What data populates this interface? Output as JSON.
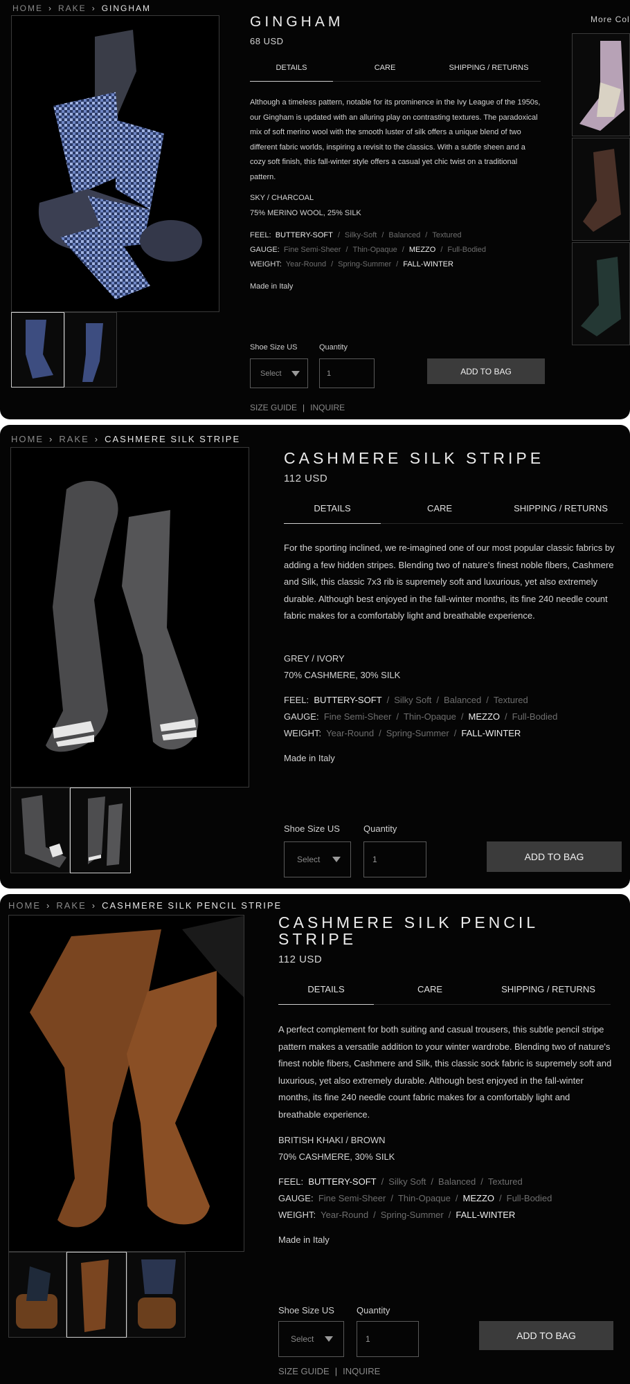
{
  "products": [
    {
      "breadcrumb": {
        "home": "HOME",
        "rake": "RAKE",
        "current": "GINGHAM"
      },
      "title": "GINGHAM",
      "price": "68 USD",
      "tabs": [
        "DETAILS",
        "CARE",
        "SHIPPING / RETURNS"
      ],
      "description": "Although a timeless pattern, notable for its prominence in the Ivy League of the 1950s, our Gingham is updated with an alluring play on contrasting textures.  The paradoxical mix of soft merino wool with the smooth luster of silk offers a unique blend of two different fabric worlds, inspiring a revisit to the classics.  With a subtle sheen and a cozy soft finish, this fall-winter style offers a casual yet chic twist on a traditional pattern.",
      "color": "SKY / CHARCOAL",
      "material": "75% MERINO WOOL, 25% SILK",
      "feel": {
        "label": "FEEL:",
        "opts": [
          "BUTTERY-SOFT",
          "Silky-Soft",
          "Balanced",
          "Textured"
        ]
      },
      "gauge": {
        "label": "GAUGE:",
        "opts": [
          "Fine Semi-Sheer",
          "Thin-Opaque",
          "MEZZO",
          "Full-Bodied"
        ]
      },
      "weight": {
        "label": "WEIGHT:",
        "opts": [
          "Year-Round",
          "Spring-Summer",
          "FALL-WINTER"
        ]
      },
      "origin": "Made in Italy",
      "size_label": "Shoe Size US",
      "size_value": "Select",
      "qty_label": "Quantity",
      "qty_value": "1",
      "add_label": "ADD TO BAG",
      "size_guide": "SIZE GUIDE",
      "inquire": "INQUIRE",
      "more_colors": "More Colo"
    },
    {
      "breadcrumb": {
        "home": "HOME",
        "rake": "RAKE",
        "current": "CASHMERE SILK STRIPE"
      },
      "title": "CASHMERE SILK STRIPE",
      "price": "112 USD",
      "tabs": [
        "DETAILS",
        "CARE",
        "SHIPPING / RETURNS"
      ],
      "description": "For the sporting inclined, we re-imagined one of our most popular classic fabrics by adding a few hidden stripes.  Blending two of nature's finest noble fibers, Cashmere and Silk, this classic 7x3 rib is supremely soft and luxurious, yet also extremely durable.  Although best enjoyed in the fall-winter months, its fine 240 needle count fabric makes for a comfortably light and breathable experience.",
      "color": "GREY / IVORY",
      "material": "70% CASHMERE, 30% SILK",
      "feel": {
        "label": "FEEL:",
        "opts": [
          "BUTTERY-SOFT",
          "Silky Soft",
          "Balanced",
          "Textured"
        ]
      },
      "gauge": {
        "label": "GAUGE:",
        "opts": [
          "Fine Semi-Sheer",
          "Thin-Opaque",
          "MEZZO",
          "Full-Bodied"
        ]
      },
      "weight": {
        "label": "WEIGHT:",
        "opts": [
          "Year-Round",
          "Spring-Summer",
          "FALL-WINTER"
        ]
      },
      "origin": "Made in Italy",
      "size_label": "Shoe Size US",
      "size_value": "Select",
      "qty_label": "Quantity",
      "qty_value": "1",
      "add_label": "ADD TO BAG"
    },
    {
      "breadcrumb": {
        "home": "HOME",
        "rake": "RAKE",
        "current": "CASHMERE SILK PENCIL STRIPE"
      },
      "title_line1": "CASHMERE SILK PENCIL",
      "title_line2": "STRIPE",
      "price": "112 USD",
      "tabs": [
        "DETAILS",
        "CARE",
        "SHIPPING / RETURNS"
      ],
      "description": "A perfect complement for both suiting and casual trousers, this subtle pencil stripe pattern makes a versatile addition to your winter wardrobe. Blending two of nature's finest noble fibers, Cashmere and Silk, this classic sock fabric is supremely soft and luxurious, yet also extremely durable.  Although best enjoyed in the fall-winter months, its fine 240 needle count fabric makes for a comfortably light and breathable experience.",
      "color": "BRITISH KHAKI / BROWN",
      "material": "70% CASHMERE, 30% SILK",
      "feel": {
        "label": "FEEL:",
        "opts": [
          "BUTTERY-SOFT",
          "Silky Soft",
          "Balanced",
          "Textured"
        ]
      },
      "gauge": {
        "label": "GAUGE:",
        "opts": [
          "Fine Semi-Sheer",
          "Thin-Opaque",
          "MEZZO",
          "Full-Bodied"
        ]
      },
      "weight": {
        "label": "WEIGHT:",
        "opts": [
          "Year-Round",
          "Spring-Summer",
          "FALL-WINTER"
        ]
      },
      "origin": "Made in Italy",
      "size_label": "Shoe Size US",
      "size_value": "Select",
      "qty_label": "Quantity",
      "qty_value": "1",
      "add_label": "ADD TO BAG",
      "size_guide": "SIZE GUIDE",
      "inquire": "INQUIRE"
    }
  ],
  "icons": {
    "caret": "chevron-down-icon",
    "breadcrumb_sep": "chevron-right-icon"
  },
  "colors": {
    "background": "#050505",
    "button": "#3b3b3b",
    "text": "#d4d4d4",
    "muted": "#6e6e6e"
  }
}
